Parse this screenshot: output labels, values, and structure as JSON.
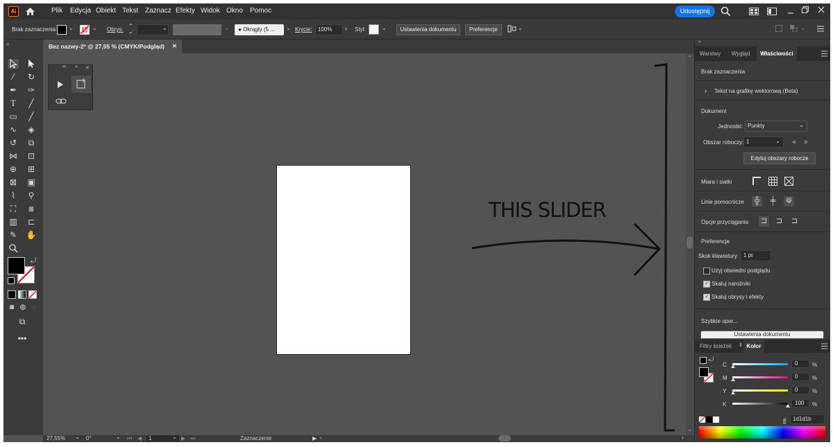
{
  "menubar": {
    "logo": "Ai",
    "items": [
      "Plik",
      "Edycja",
      "Obiekt",
      "Tekst",
      "Zaznacz",
      "Efekty",
      "Widok",
      "Okno",
      "Pomoc"
    ],
    "share_label": "Udostępnij"
  },
  "control_bar": {
    "selection_label": "Brak zaznaczenia",
    "stroke_label": "Obrys:",
    "brush_label": "Okrągły (5 ...",
    "opacity_label": "Krycie:",
    "opacity_value": "100%",
    "style_label": "Styl:",
    "doc_settings_button": "Ustawienia dokumentu",
    "preferences_button": "Preferencje"
  },
  "document": {
    "tab_title": "Bez nazwy-2* @ 27,55 % (CMYK/Podgląd)",
    "close_glyph": "✕"
  },
  "annotation": {
    "text": "THIS SLIDER"
  },
  "statusbar": {
    "zoom": "27,55%",
    "rotation": "0°",
    "artboard": "1",
    "tool": "Zaznaczenie"
  },
  "properties_panel": {
    "tabs": [
      "Warstwy",
      "Wygląd",
      "Właściwości"
    ],
    "active_tab": "Właściwości",
    "no_selection": "Brak zaznaczenia",
    "text_to_vector": "Tekst na grafikę wektorową (Beta)",
    "document_section": "Dokument",
    "units_label": "Jednostki:",
    "units_value": "Punkty",
    "artboard_label": "Obszar roboczy:",
    "artboard_value": "1",
    "edit_artboards_button": "Edytuj obszary robocze",
    "rulers_label": "Miara i siatki",
    "guides_label": "Linie pomocnicze",
    "snap_label": "Opcje przyciągania",
    "preferences_section": "Preferencje",
    "keyboard_increment_label": "Skok klawiatury:",
    "keyboard_increment_value": "1 pt",
    "checkboxes": [
      {
        "label": "Użyj obwiedni podglądu",
        "checked": false
      },
      {
        "label": "Skaluj narożniki",
        "checked": true
      },
      {
        "label": "Skaluj obrysy i efekty",
        "checked": true
      }
    ],
    "quick_actions": "Szybkie oper...",
    "doc_settings_button": "Ustawienia dokumentu"
  },
  "color_panel": {
    "tabs": [
      "Filtry ścieżek",
      "Kolor"
    ],
    "active_tab": "Kolor",
    "channels": [
      {
        "label": "C",
        "value": "0",
        "unit": "%",
        "color": "#00aeef"
      },
      {
        "label": "M",
        "value": "0",
        "unit": "%",
        "color": "#ec008c"
      },
      {
        "label": "Y",
        "value": "0",
        "unit": "%",
        "color": "#fff200"
      },
      {
        "label": "K",
        "value": "100",
        "unit": "%",
        "color": "#000000"
      }
    ],
    "hex_prefix": "#",
    "hex_value": "1d1d1b"
  },
  "colors": {
    "accent": "#1473e6",
    "ui_dark": "#323232",
    "canvas": "#535353"
  }
}
